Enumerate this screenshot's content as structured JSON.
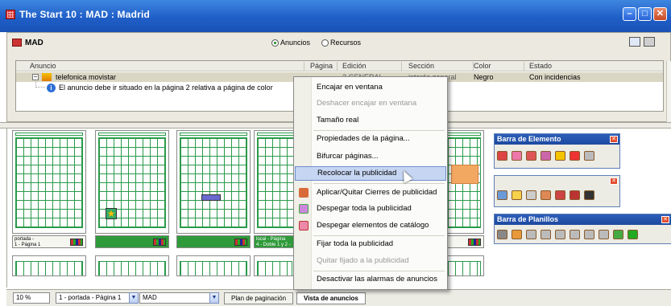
{
  "window": {
    "title": "The Start 10 : MAD : Madrid",
    "controls": [
      "minimize",
      "maximize",
      "close"
    ]
  },
  "panel": {
    "section_label": "MAD",
    "radio": {
      "anuncios": "Anuncios",
      "recursos": "Recursos",
      "selected": "Anuncios"
    },
    "grid": {
      "columns": [
        "Anuncio",
        "Página",
        "Edición",
        "Sección",
        "Color",
        "Estado"
      ],
      "rows": [
        {
          "anuncio": "telefonica movistar",
          "pagina": "",
          "edicion": "2 GENERAL",
          "seccion": "interés general",
          "color": "Negro",
          "estado": "Con incidencias"
        }
      ],
      "message": "El anuncio debe ir situado en la página 2 relativa a página de color"
    }
  },
  "pages": [
    {
      "label_line1": "portada -",
      "label_line2": "1 - Página 1",
      "style": "plain"
    },
    {
      "label_line1": "",
      "label_line2": "",
      "style": "green"
    },
    {
      "label_line1": "",
      "label_line2": "",
      "style": "green"
    },
    {
      "label_line1": "local - Página",
      "label_line2": "4 - Doble 1 y 2 -",
      "style": "green"
    },
    {
      "label_line1": "",
      "label_line2": "",
      "style": "plain"
    }
  ],
  "toolbars": {
    "elemento": {
      "title": "Barra de Elemento",
      "icons": [
        "edit-icon",
        "star-icon",
        "cut-icon",
        "paint-icon",
        "hand-icon",
        "list-icon",
        "lock-icon"
      ]
    },
    "unnamed": {
      "title": "",
      "icons": [
        "zoom-icon",
        "bulb-icon",
        "grid-icon",
        "pen-icon",
        "page-icon",
        "book-icon",
        "binoculars-icon"
      ]
    },
    "planillos": {
      "title": "Barra de Planillos",
      "icons": [
        "save-icon",
        "gear-icon",
        "page-icon",
        "page-icon",
        "page-icon",
        "page-icon",
        "page-icon",
        "page-icon",
        "edit-icon",
        "check-icon"
      ]
    }
  },
  "context_menu": {
    "items": [
      {
        "label": "Encajar en ventana",
        "enabled": true
      },
      {
        "label": "Deshacer encajar en ventana",
        "enabled": false
      },
      {
        "label": "Tamaño real",
        "enabled": true
      },
      {
        "label": "Propiedades de la página...",
        "enabled": true
      },
      {
        "label": "Bifurcar páginas...",
        "enabled": true
      },
      {
        "label": "Recolocar la publicidad",
        "enabled": true,
        "highlighted": true
      },
      {
        "label": "Aplicar/Quitar Cierres de publicidad",
        "enabled": true,
        "icon": "lock-edit-icon"
      },
      {
        "label": "Despegar toda la publicidad",
        "enabled": true,
        "icon": "detach-icon"
      },
      {
        "label": "Despegar elementos de catálogo",
        "enabled": true,
        "icon": "catalog-icon"
      },
      {
        "label": "Fijar toda la publicidad",
        "enabled": true
      },
      {
        "label": "Quitar fijado a la publicidad",
        "enabled": false
      },
      {
        "label": "Desactivar las alarmas de anuncios",
        "enabled": true
      }
    ]
  },
  "status_bar": {
    "zoom": "10 %",
    "page_select": "1 - portada - Página 1",
    "edition_select": "MAD",
    "tabs": [
      "Plan de paginación",
      "Vista de anuncios"
    ],
    "active_tab": "Vista de anuncios"
  },
  "colors": {
    "titlebar": "#1f5fc8",
    "highlight": "#c6d6f2",
    "page_grid": "#2a9a4a",
    "ad_orange": "#f3a862"
  }
}
